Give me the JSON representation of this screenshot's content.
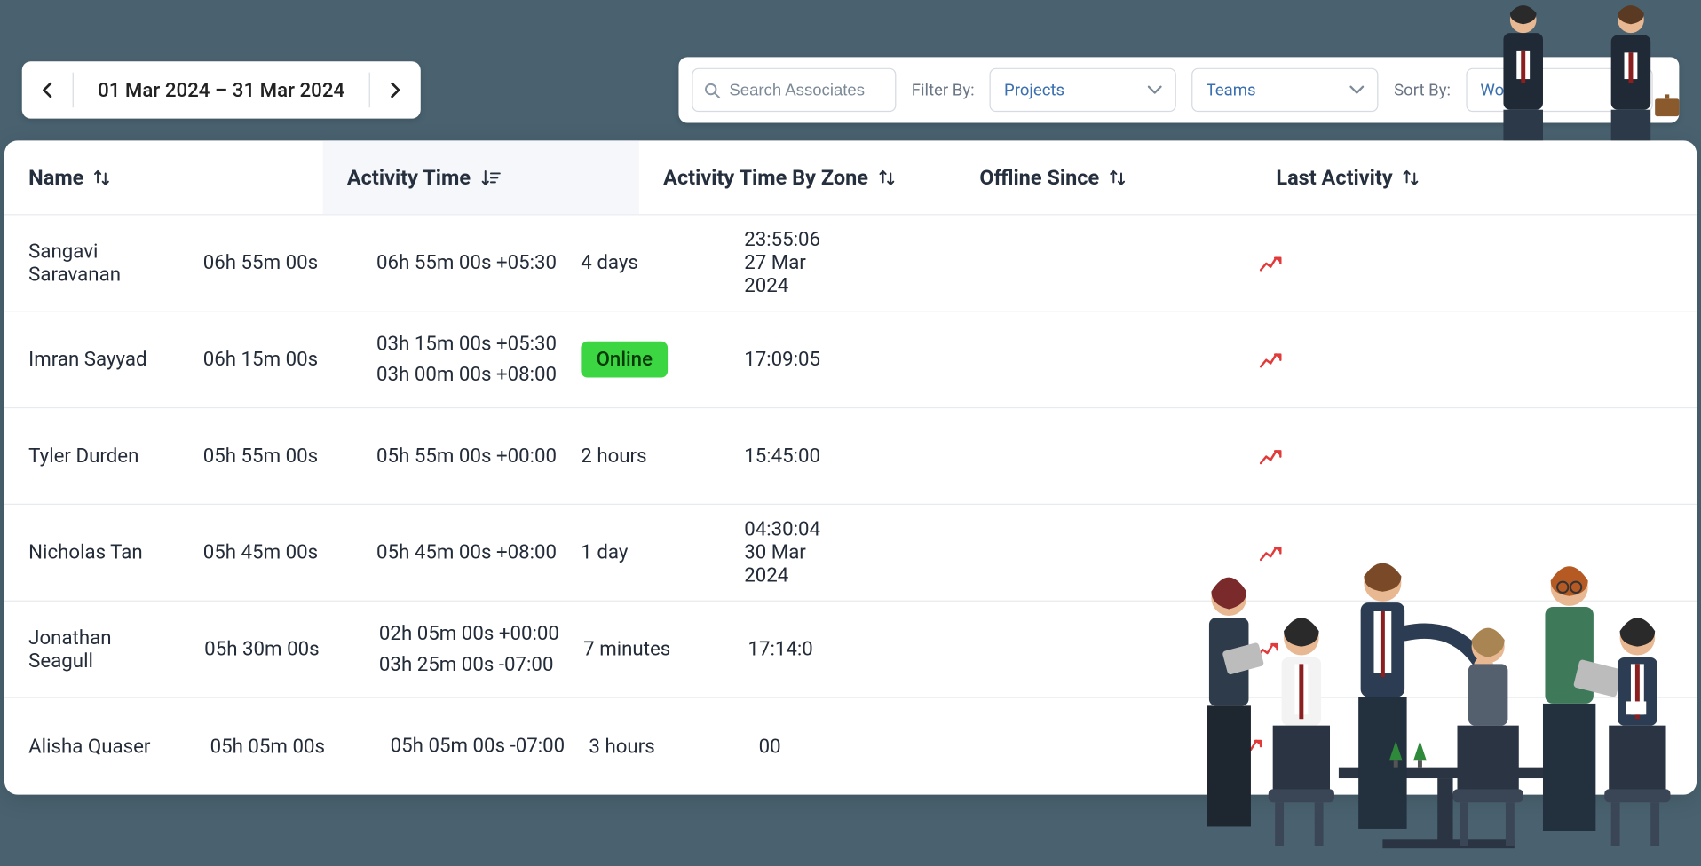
{
  "dateRange": "01 Mar 2024 – 31 Mar 2024",
  "search": {
    "placeholder": "Search Associates"
  },
  "filterLabel": "Filter By:",
  "sortLabel": "Sort By:",
  "dropdowns": {
    "projects": "Projects",
    "teams": "Teams",
    "working": "Working"
  },
  "columns": {
    "name": "Name",
    "activityTime": "Activity Time",
    "zone": "Activity Time By Zone",
    "offline": "Offline Since",
    "last": "Last Activity"
  },
  "rows": [
    {
      "name": "Sangavi Saravanan",
      "at": "06h 55m 00s",
      "zones": [
        "06h 55m 00s +05:30"
      ],
      "offline": "4 days",
      "offlineBadge": false,
      "last": "23:55:06 27 Mar 2024"
    },
    {
      "name": "Imran Sayyad",
      "at": "06h 15m 00s",
      "zones": [
        "03h 15m 00s +05:30",
        "03h 00m 00s +08:00"
      ],
      "offline": "Online",
      "offlineBadge": true,
      "last": "17:09:05"
    },
    {
      "name": "Tyler Durden",
      "at": "05h 55m 00s",
      "zones": [
        "05h 55m 00s +00:00"
      ],
      "offline": "2 hours",
      "offlineBadge": false,
      "last": "15:45:00"
    },
    {
      "name": "Nicholas Tan",
      "at": "05h 45m 00s",
      "zones": [
        "05h 45m 00s +08:00"
      ],
      "offline": "1 day",
      "offlineBadge": false,
      "last": "04:30:04 30 Mar 2024"
    },
    {
      "name": "Jonathan Seagull",
      "at": "05h 30m 00s",
      "zones": [
        "02h 05m 00s +00:00",
        "03h 25m 00s -07:00"
      ],
      "offline": "7 minutes",
      "offlineBadge": false,
      "last": "17:14:0"
    },
    {
      "name": "Alisha Quaser",
      "at": "05h 05m 00s",
      "zones": [
        "05h 05m 00s -07:00"
      ],
      "offline": "3 hours",
      "offlineBadge": false,
      "last": "00"
    }
  ]
}
